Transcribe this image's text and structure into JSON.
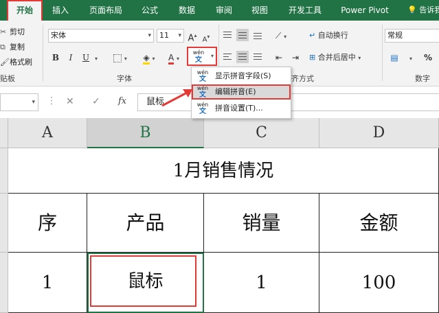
{
  "ribbon_tabs": [
    "开始",
    "插入",
    "页面布局",
    "公式",
    "数据",
    "审阅",
    "视图",
    "开发工具",
    "Power Pivot"
  ],
  "tell_me": "告诉我",
  "clipboard": {
    "cut": "剪切",
    "copy": "复制",
    "format_painter": "格式刷",
    "group_label": "贴板"
  },
  "font": {
    "name": "宋体",
    "size": "11",
    "grow_label": "A",
    "shrink_label": "A",
    "bold_label": "B",
    "italic_label": "I",
    "underline_label": "U",
    "font_color_letter": "A",
    "group_label": "字体"
  },
  "phonetic": {
    "top": "wén",
    "char": "文"
  },
  "alignment": {
    "wrap_text": "自动换行",
    "merge_center": "合并后居中",
    "group_label_partial": "齐方式"
  },
  "number": {
    "format": "常规",
    "group_label": "数字"
  },
  "phonetic_menu": {
    "items": [
      "显示拼音字段(S)",
      "编辑拼音(E)",
      "拼音设置(T)..."
    ]
  },
  "formula_bar": {
    "fx": "fx",
    "content": "鼠标"
  },
  "columns": [
    "A",
    "B",
    "C",
    "D"
  ],
  "sheet": {
    "title": "1月销售情况",
    "headers": [
      "序",
      "产品",
      "销量",
      "金额"
    ],
    "rows": [
      [
        "1",
        "鼠标",
        "1",
        "100"
      ]
    ]
  },
  "colors": {
    "accent": "#217346",
    "highlight": "#e53935",
    "link": "#1e6fc4"
  }
}
